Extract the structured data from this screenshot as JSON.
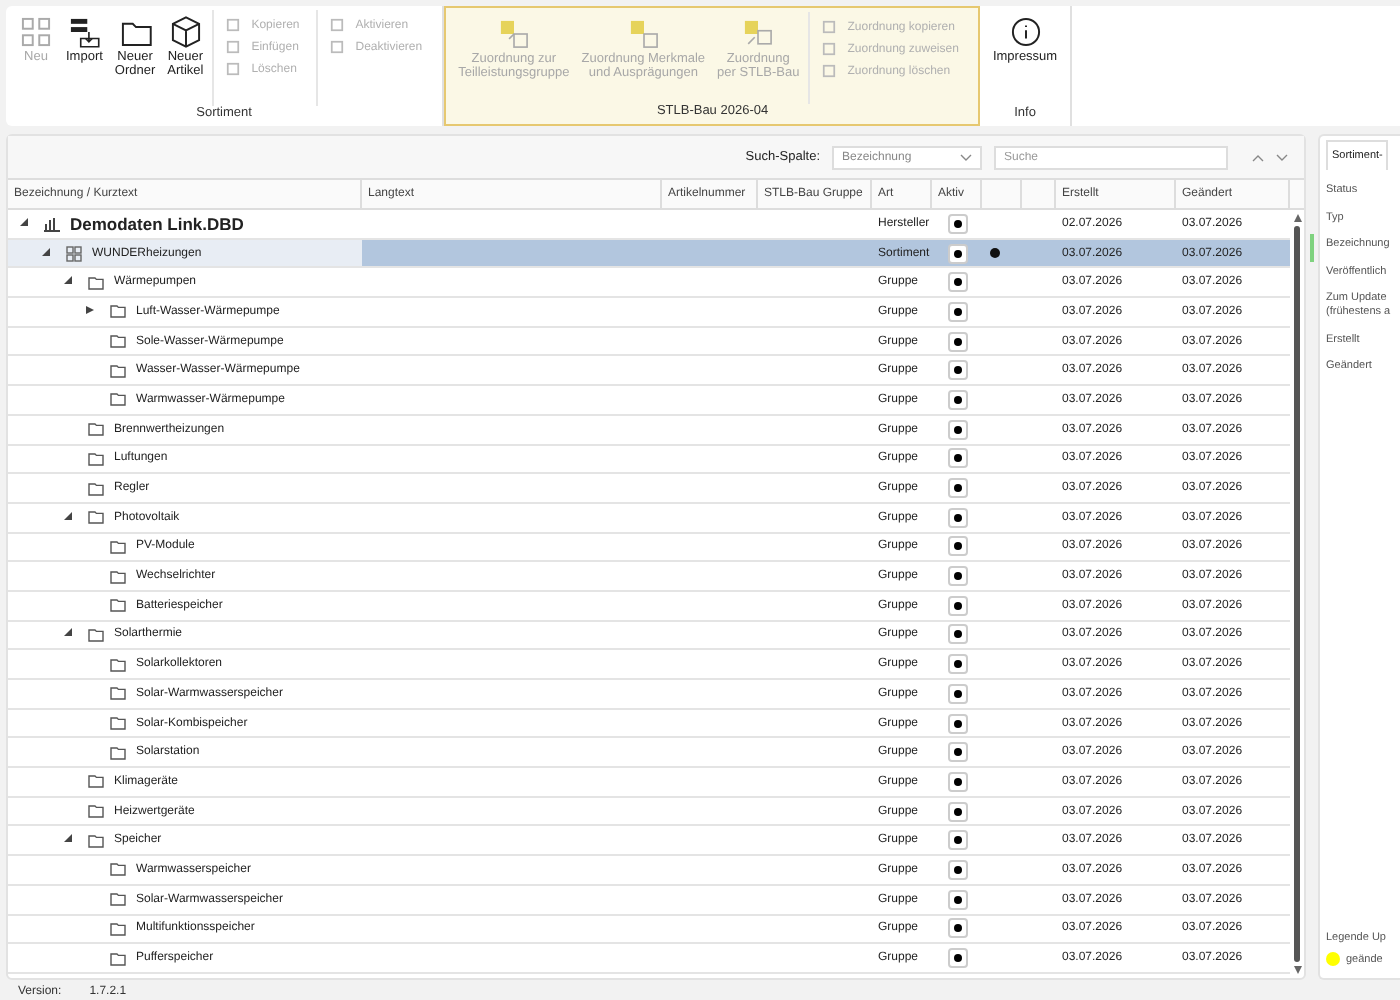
{
  "ribbon": {
    "groups": [
      {
        "title": "Sortiment",
        "highlighted": false,
        "items": [
          {
            "kind": "large",
            "label": "Neu",
            "disabled": true
          },
          {
            "kind": "large",
            "label": "Import",
            "disabled": false
          },
          {
            "kind": "large",
            "label": "Neuer\nOrdner",
            "disabled": false
          },
          {
            "kind": "large",
            "label": "Neuer\nArtikel",
            "disabled": false
          },
          {
            "kind": "stack",
            "items": [
              {
                "label": "Kopieren",
                "disabled": true
              },
              {
                "label": "Einfügen",
                "disabled": true
              },
              {
                "label": "Löschen",
                "disabled": true
              }
            ]
          },
          {
            "kind": "stack",
            "items": [
              {
                "label": "Aktivieren",
                "disabled": true
              },
              {
                "label": "Deaktivieren",
                "disabled": true
              }
            ]
          }
        ]
      },
      {
        "title": "STLB-Bau 2026-04",
        "highlighted": true,
        "items": [
          {
            "kind": "large",
            "label": "Zuordnung zur\nTeilleistungsgruppe",
            "disabled": true
          },
          {
            "kind": "large",
            "label": "Zuordnung Merkmale\nund Ausprägungen",
            "disabled": true
          },
          {
            "kind": "large",
            "label": "Zuordnung\nper STLB-Bau",
            "disabled": true
          },
          {
            "kind": "stack",
            "items": [
              {
                "label": "Zuordnung kopieren",
                "disabled": true
              },
              {
                "label": "Zuordnung zuweisen",
                "disabled": true
              },
              {
                "label": "Zuordnung löschen",
                "disabled": true
              }
            ]
          }
        ]
      },
      {
        "title": "Info",
        "highlighted": false,
        "items": [
          {
            "kind": "large",
            "label": "Impressum",
            "disabled": false
          }
        ]
      }
    ]
  },
  "search": {
    "label": "Such-Spalte:",
    "column": "Bezeichnung",
    "placeholder": "Suche"
  },
  "table": {
    "columns": [
      "Bezeichnung / Kurztext",
      "Langtext",
      "Artikelnummer",
      "STLB-Bau Gruppe",
      "Art",
      "Aktiv",
      "Erstellt",
      "Geändert"
    ],
    "rows": [
      {
        "kind": "manufacturer",
        "name": "Demodaten Link.DBD",
        "art": "Hersteller",
        "active": true,
        "marked": false,
        "selected": false,
        "expanded": true,
        "created": "02.07.2026",
        "changed": "03.07.2026",
        "children": [
          {
            "kind": "assortment",
            "name": "WUNDERheizungen",
            "art": "Sortiment",
            "active": true,
            "marked": true,
            "selected": true,
            "expanded": true,
            "created": "03.07.2026",
            "changed": "03.07.2026",
            "children": [
              {
                "kind": "group",
                "name": "Wärmepumpen",
                "art": "Gruppe",
                "active": true,
                "marked": false,
                "selected": false,
                "expanded": true,
                "created": "03.07.2026",
                "changed": "03.07.2026",
                "children": [
                  {
                    "kind": "group",
                    "name": "Luft-Wasser-Wärmepumpe",
                    "art": "Gruppe",
                    "active": true,
                    "marked": false,
                    "selected": false,
                    "expanded": false,
                    "created": "03.07.2026",
                    "changed": "03.07.2026"
                  },
                  {
                    "kind": "group",
                    "name": "Sole-Wasser-Wärmepumpe",
                    "art": "Gruppe",
                    "active": true,
                    "marked": false,
                    "selected": false,
                    "created": "03.07.2026",
                    "changed": "03.07.2026"
                  },
                  {
                    "kind": "group",
                    "name": "Wasser-Wasser-Wärmepumpe",
                    "art": "Gruppe",
                    "active": true,
                    "marked": false,
                    "selected": false,
                    "created": "03.07.2026",
                    "changed": "03.07.2026"
                  },
                  {
                    "kind": "group",
                    "name": "Warmwasser-Wärmepumpe",
                    "art": "Gruppe",
                    "active": true,
                    "marked": false,
                    "selected": false,
                    "created": "03.07.2026",
                    "changed": "03.07.2026"
                  }
                ]
              },
              {
                "kind": "group",
                "name": "Brennwertheizungen",
                "art": "Gruppe",
                "active": true,
                "marked": false,
                "selected": false,
                "created": "03.07.2026",
                "changed": "03.07.2026"
              },
              {
                "kind": "group",
                "name": "Luftungen",
                "art": "Gruppe",
                "active": true,
                "marked": false,
                "selected": false,
                "created": "03.07.2026",
                "changed": "03.07.2026"
              },
              {
                "kind": "group",
                "name": "Regler",
                "art": "Gruppe",
                "active": true,
                "marked": false,
                "selected": false,
                "created": "03.07.2026",
                "changed": "03.07.2026"
              },
              {
                "kind": "group",
                "name": "Photovoltaik",
                "art": "Gruppe",
                "active": true,
                "marked": false,
                "selected": false,
                "expanded": true,
                "created": "03.07.2026",
                "changed": "03.07.2026",
                "children": [
                  {
                    "kind": "group",
                    "name": "PV-Module",
                    "art": "Gruppe",
                    "active": true,
                    "marked": false,
                    "selected": false,
                    "created": "03.07.2026",
                    "changed": "03.07.2026"
                  },
                  {
                    "kind": "group",
                    "name": "Wechselrichter",
                    "art": "Gruppe",
                    "active": true,
                    "marked": false,
                    "selected": false,
                    "created": "03.07.2026",
                    "changed": "03.07.2026"
                  },
                  {
                    "kind": "group",
                    "name": "Batteriespeicher",
                    "art": "Gruppe",
                    "active": true,
                    "marked": false,
                    "selected": false,
                    "created": "03.07.2026",
                    "changed": "03.07.2026"
                  }
                ]
              },
              {
                "kind": "group",
                "name": "Solarthermie",
                "art": "Gruppe",
                "active": true,
                "marked": false,
                "selected": false,
                "expanded": true,
                "created": "03.07.2026",
                "changed": "03.07.2026",
                "children": [
                  {
                    "kind": "group",
                    "name": "Solarkollektoren",
                    "art": "Gruppe",
                    "active": true,
                    "marked": false,
                    "selected": false,
                    "created": "03.07.2026",
                    "changed": "03.07.2026"
                  },
                  {
                    "kind": "group",
                    "name": "Solar-Warmwasserspeicher",
                    "art": "Gruppe",
                    "active": true,
                    "marked": false,
                    "selected": false,
                    "created": "03.07.2026",
                    "changed": "03.07.2026"
                  },
                  {
                    "kind": "group",
                    "name": "Solar-Kombispeicher",
                    "art": "Gruppe",
                    "active": true,
                    "marked": false,
                    "selected": false,
                    "created": "03.07.2026",
                    "changed": "03.07.2026"
                  },
                  {
                    "kind": "group",
                    "name": "Solarstation",
                    "art": "Gruppe",
                    "active": true,
                    "marked": false,
                    "selected": false,
                    "created": "03.07.2026",
                    "changed": "03.07.2026"
                  }
                ]
              },
              {
                "kind": "group",
                "name": "Klimageräte",
                "art": "Gruppe",
                "active": true,
                "marked": false,
                "selected": false,
                "created": "03.07.2026",
                "changed": "03.07.2026"
              },
              {
                "kind": "group",
                "name": "Heizwertgeräte",
                "art": "Gruppe",
                "active": true,
                "marked": false,
                "selected": false,
                "created": "03.07.2026",
                "changed": "03.07.2026"
              },
              {
                "kind": "group",
                "name": "Speicher",
                "art": "Gruppe",
                "active": true,
                "marked": false,
                "selected": false,
                "expanded": true,
                "created": "03.07.2026",
                "changed": "03.07.2026",
                "children": [
                  {
                    "kind": "group",
                    "name": "Warmwasserspeicher",
                    "art": "Gruppe",
                    "active": true,
                    "marked": false,
                    "selected": false,
                    "created": "03.07.2026",
                    "changed": "03.07.2026"
                  },
                  {
                    "kind": "group",
                    "name": "Solar-Warmwasserspeicher",
                    "art": "Gruppe",
                    "active": true,
                    "marked": false,
                    "selected": false,
                    "created": "03.07.2026",
                    "changed": "03.07.2026"
                  },
                  {
                    "kind": "group",
                    "name": "Multifunktionsspeicher",
                    "art": "Gruppe",
                    "active": true,
                    "marked": false,
                    "selected": false,
                    "created": "03.07.2026",
                    "changed": "03.07.2026"
                  },
                  {
                    "kind": "group",
                    "name": "Pufferspeicher",
                    "art": "Gruppe",
                    "active": true,
                    "marked": false,
                    "selected": false,
                    "created": "03.07.2026",
                    "changed": "03.07.2026"
                  }
                ]
              }
            ]
          }
        ]
      }
    ]
  },
  "details": {
    "tab": "Sortiment-",
    "fields": [
      "Status",
      "Typ",
      "Bezeichnung",
      "Veröffentlich",
      "Zum Update\n(frühestens a",
      "Erstellt",
      "Geändert"
    ],
    "legend": {
      "title": "Legende Up",
      "items": [
        {
          "label": "geände",
          "color": "#ffff00"
        }
      ]
    }
  },
  "footer": {
    "label": "Version:",
    "value": "1.7.2.1"
  }
}
